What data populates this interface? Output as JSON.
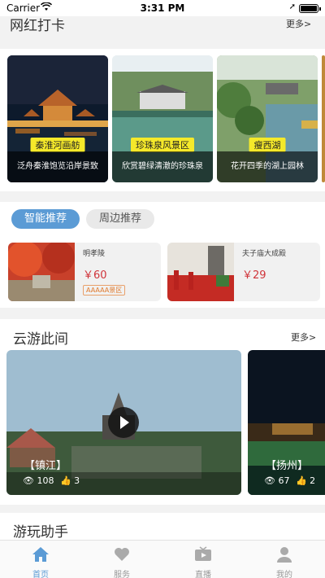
{
  "status_bar": {
    "carrier": "Carrier",
    "time": "3:31 PM"
  },
  "hot_checkin": {
    "title": "网红打卡",
    "more": "更多>",
    "cards": [
      {
        "tag": "秦淮河画舫",
        "desc": "泛舟秦淮饱览沿岸景致"
      },
      {
        "tag": "珍珠泉风景区",
        "desc": "欣赏碧绿清澈的珍珠泉"
      },
      {
        "tag": "瘦西湖",
        "desc": "花开四季的湖上园林"
      }
    ]
  },
  "recommend": {
    "tabs": [
      {
        "label": "智能推荐",
        "active": true
      },
      {
        "label": "周边推荐",
        "active": false
      }
    ],
    "items": [
      {
        "name": "明孝陵",
        "price": "￥60",
        "badge": "AAAAA景区"
      },
      {
        "name": "夫子庙大成殿",
        "price": "￥29",
        "badge": ""
      }
    ]
  },
  "cloud_tour": {
    "title": "云游此间",
    "more": "更多>",
    "videos": [
      {
        "label": "【镇江】",
        "views": "108",
        "likes": "3"
      },
      {
        "label": "【扬州】",
        "views": "67",
        "likes": "2"
      }
    ]
  },
  "helper": {
    "title": "游玩助手"
  },
  "tabbar": {
    "items": [
      {
        "label": "首页",
        "icon": "home-icon",
        "active": true
      },
      {
        "label": "服务",
        "icon": "heart-icon",
        "active": false
      },
      {
        "label": "直播",
        "icon": "live-tv-icon",
        "active": false
      },
      {
        "label": "我的",
        "icon": "user-icon",
        "active": false
      }
    ]
  },
  "colors": {
    "accent": "#5b9bd5",
    "tag_yellow": "#f5e92a",
    "price_red": "#d0343a"
  }
}
